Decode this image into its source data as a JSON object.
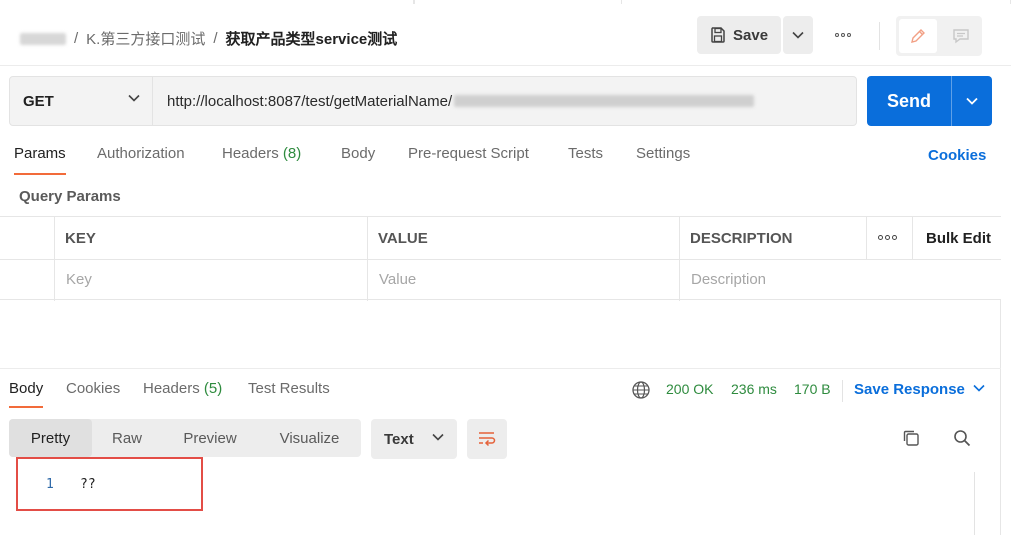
{
  "header": {
    "breadcrumb": {
      "collection": "K.第三方接口测试",
      "separator": "/",
      "request": "获取产品类型service测试"
    },
    "save_label": "Save",
    "icons": {
      "save": "save-disk-icon",
      "save_dropdown": "chevron-down-icon",
      "more": "more-horizontal-icon",
      "edit": "pencil-icon",
      "comments": "comment-icon"
    }
  },
  "request": {
    "method": "GET",
    "url": "http://localhost:8087/test/getMaterialName/",
    "send_label": "Send"
  },
  "request_tabs": [
    {
      "label": "Params",
      "active": true
    },
    {
      "label": "Authorization"
    },
    {
      "label": "Headers",
      "count": "(8)"
    },
    {
      "label": "Body"
    },
    {
      "label": "Pre-request Script"
    },
    {
      "label": "Tests"
    },
    {
      "label": "Settings"
    }
  ],
  "cookies_link": "Cookies",
  "query_params": {
    "title": "Query Params",
    "columns": [
      "KEY",
      "VALUE",
      "DESCRIPTION"
    ],
    "bulk_edit": "Bulk Edit",
    "placeholders": {
      "key": "Key",
      "value": "Value",
      "description": "Description"
    }
  },
  "response": {
    "tabs": [
      {
        "label": "Body",
        "active": true
      },
      {
        "label": "Cookies"
      },
      {
        "label": "Headers",
        "count": "(5)"
      },
      {
        "label": "Test Results"
      }
    ],
    "status": "200 OK",
    "time": "236 ms",
    "size": "170 B",
    "save_response": "Save Response",
    "view_modes": [
      "Pretty",
      "Raw",
      "Preview",
      "Visualize"
    ],
    "active_view": "Pretty",
    "format": "Text",
    "body_lines": [
      {
        "number": "1",
        "text": "??"
      }
    ]
  },
  "colors": {
    "accent_blue": "#0a6edb",
    "tab_underline": "#f26b3a",
    "success_green": "#2e8b3e",
    "highlight_red": "#e34d46"
  }
}
